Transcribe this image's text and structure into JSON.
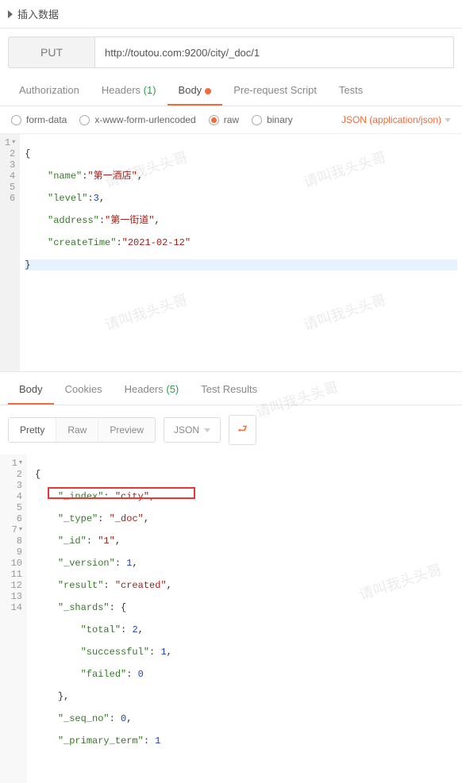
{
  "header": {
    "title": "插入数据"
  },
  "request": {
    "method": "PUT",
    "url": "http://toutou.com:9200/city/_doc/1"
  },
  "tabs": {
    "authorization": "Authorization",
    "headers_label": "Headers",
    "headers_count": "(1)",
    "body": "Body",
    "prereq": "Pre-request Script",
    "tests": "Tests"
  },
  "body_config": {
    "form_data": "form-data",
    "urlencoded": "x-www-form-urlencoded",
    "raw": "raw",
    "binary": "binary",
    "content_type": "JSON (application/json)"
  },
  "req_body": {
    "lines": [
      "1",
      "2",
      "3",
      "4",
      "5",
      "6"
    ],
    "l1": "{",
    "l2_key": "\"name\"",
    "l2_sep": ":",
    "l2_val": "\"第一酒店\"",
    "l2_end": ",",
    "l3_key": "\"level\"",
    "l3_sep": ":",
    "l3_val": "3",
    "l3_end": ",",
    "l4_key": "\"address\"",
    "l4_sep": ":",
    "l4_val": "\"第一街道\"",
    "l4_end": ",",
    "l5_key": "\"createTime\"",
    "l5_sep": ":",
    "l5_val": "\"2021-02-12\"",
    "l6": "}"
  },
  "resp_tabs": {
    "body": "Body",
    "cookies": "Cookies",
    "headers_label": "Headers",
    "headers_count": "(5)",
    "tests": "Test Results"
  },
  "resp_controls": {
    "pretty": "Pretty",
    "raw": "Raw",
    "preview": "Preview",
    "format": "JSON"
  },
  "resp_body": {
    "lines": [
      "1",
      "2",
      "3",
      "4",
      "5",
      "6",
      "7",
      "8",
      "9",
      "10",
      "11",
      "12",
      "13",
      "14"
    ],
    "l1": "{",
    "l2_k": "\"_index\"",
    "l2_v": "\"city\"",
    "l3_k": "\"_type\"",
    "l3_v": "\"_doc\"",
    "l4_k": "\"_id\"",
    "l4_v": "\"1\"",
    "l5_k": "\"_version\"",
    "l5_v": "1",
    "l6_k": "\"result\"",
    "l6_v": "\"created\"",
    "l7_k": "\"_shards\"",
    "l8_k": "\"total\"",
    "l8_v": "2",
    "l9_k": "\"successful\"",
    "l9_v": "1",
    "l10_k": "\"failed\"",
    "l10_v": "0",
    "l11": "},",
    "l12_k": "\"_seq_no\"",
    "l12_v": "0",
    "l13_k": "\"_primary_term\"",
    "l13_v": "1"
  },
  "watermark": "请叫我头头哥"
}
